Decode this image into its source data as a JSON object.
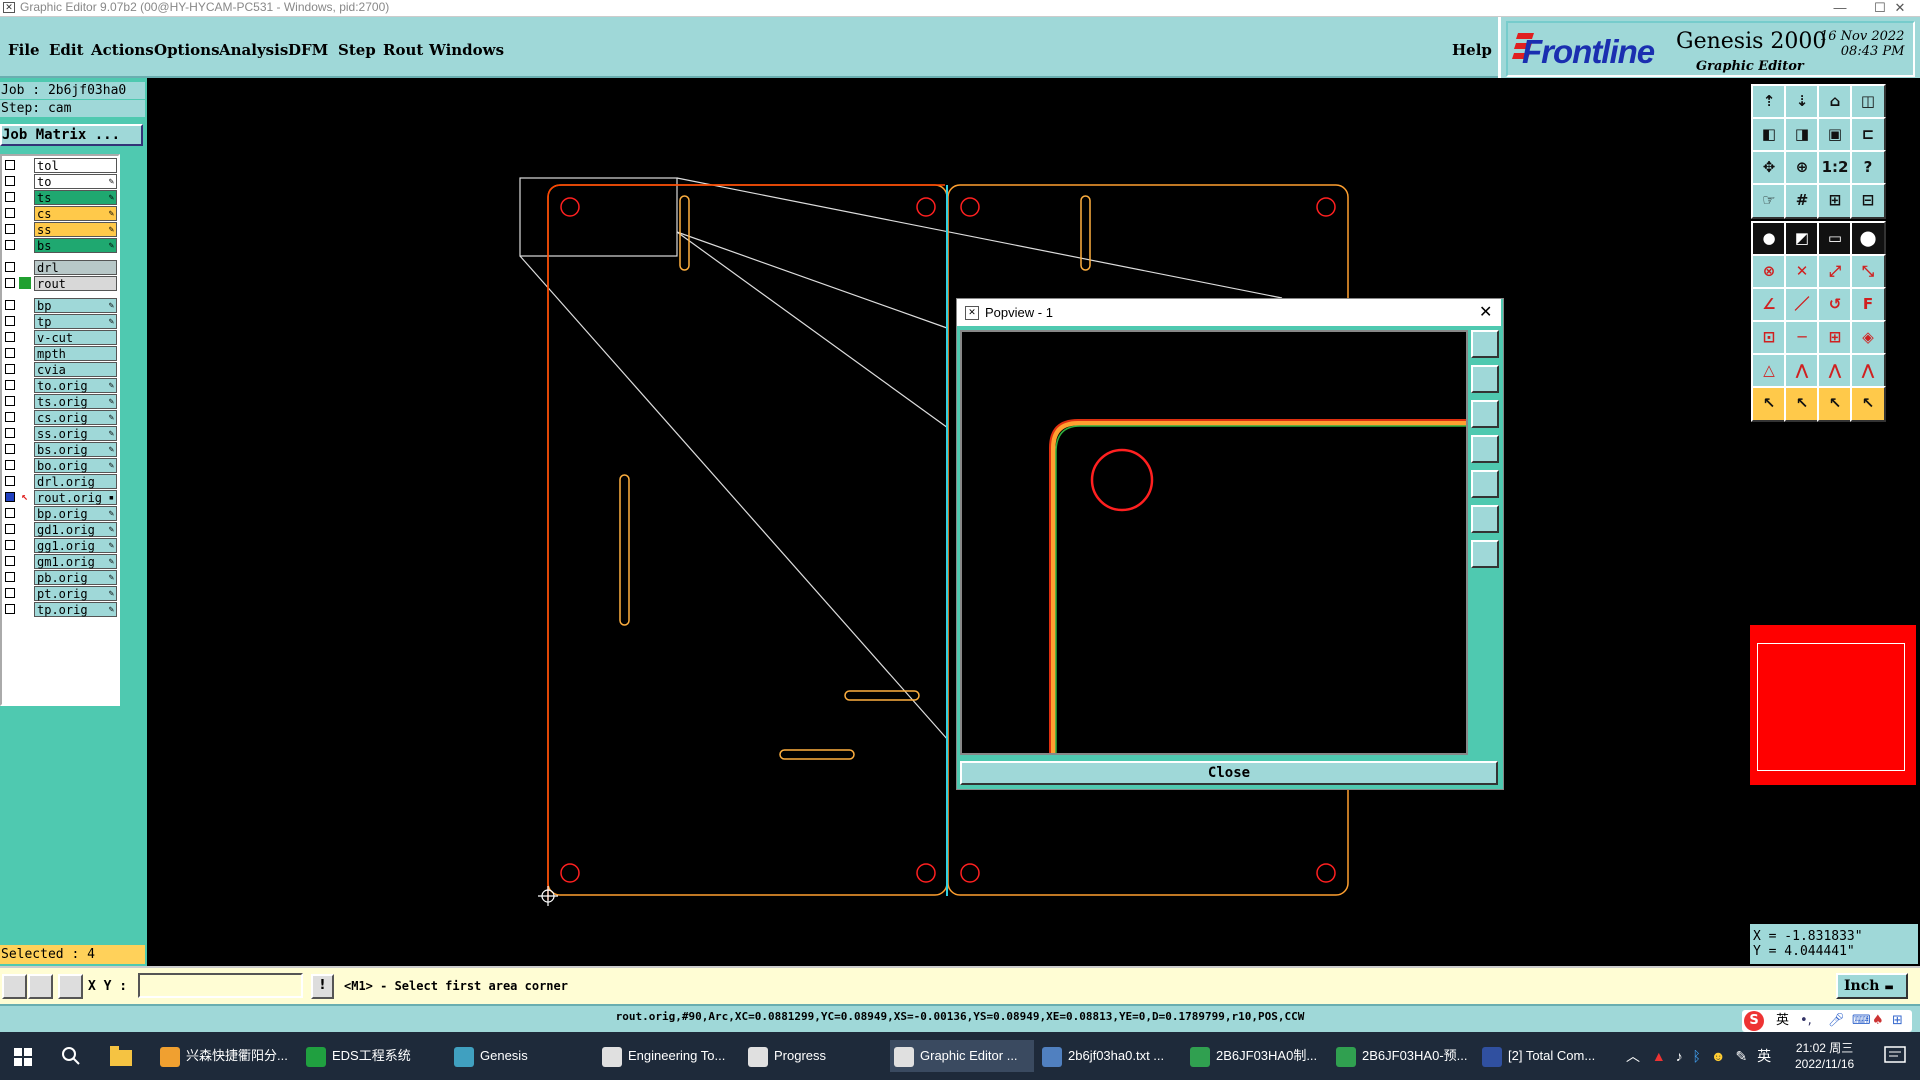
{
  "window": {
    "title": "Graphic Editor 9.07b2 (00@HY-HYCAM-PC531 - Windows, pid:2700)",
    "min": "—",
    "max": "☐",
    "close": "✕"
  },
  "menu": [
    "File",
    "Edit",
    "Actions",
    "Options",
    "Analysis",
    "DFM",
    "Step",
    "Rout",
    "Windows"
  ],
  "help": "Help",
  "logo": {
    "brand": "Frontline",
    "product": "Genesis 2000",
    "subtitle": "Graphic Editor",
    "date": "16 Nov 2022",
    "time": "08:43 PM"
  },
  "job": {
    "job_line": "Job : 2b6jf03ha0",
    "step_line": "Step: cam",
    "matrix_button": "Job Matrix ..."
  },
  "layers": [
    {
      "name": "tol",
      "color": "#ffffff",
      "edit": ""
    },
    {
      "name": "to",
      "color": "#ffffff",
      "edit": "✎"
    },
    {
      "name": "ts",
      "color": "#1fa870",
      "edit": "✎"
    },
    {
      "name": "cs",
      "color": "#ffc94a",
      "edit": "✎"
    },
    {
      "name": "ss",
      "color": "#ffc94a",
      "edit": "✎"
    },
    {
      "name": "bs",
      "color": "#1fa870",
      "edit": "✎"
    },
    {
      "name": "drl",
      "color": "#b8c8c8",
      "edit": ""
    },
    {
      "name": "rout",
      "color": "#d8d8d8",
      "edit": ""
    },
    {
      "name": "bp",
      "color": "#9fd8d8",
      "edit": "✎"
    },
    {
      "name": "tp",
      "color": "#9fd8d8",
      "edit": "✎"
    },
    {
      "name": "v-cut",
      "color": "#9fd8d8",
      "edit": ""
    },
    {
      "name": "mpth",
      "color": "#9fd8d8",
      "edit": ""
    },
    {
      "name": "cvia",
      "color": "#9fd8d8",
      "edit": ""
    },
    {
      "name": "to.orig",
      "color": "#9fd8d8",
      "edit": "✎"
    },
    {
      "name": "ts.orig",
      "color": "#9fd8d8",
      "edit": "✎"
    },
    {
      "name": "cs.orig",
      "color": "#9fd8d8",
      "edit": "✎"
    },
    {
      "name": "ss.orig",
      "color": "#9fd8d8",
      "edit": "✎"
    },
    {
      "name": "bs.orig",
      "color": "#9fd8d8",
      "edit": "✎"
    },
    {
      "name": "bo.orig",
      "color": "#9fd8d8",
      "edit": "✎"
    },
    {
      "name": "drl.orig",
      "color": "#9fd8d8",
      "edit": ""
    },
    {
      "name": "rout.orig",
      "color": "#9fd8d8",
      "edit": "▪"
    },
    {
      "name": "bp.orig",
      "color": "#9fd8d8",
      "edit": "✎"
    },
    {
      "name": "gd1.orig",
      "color": "#9fd8d8",
      "edit": "✎"
    },
    {
      "name": "gg1.orig",
      "color": "#9fd8d8",
      "edit": "✎"
    },
    {
      "name": "gm1.orig",
      "color": "#9fd8d8",
      "edit": "✎"
    },
    {
      "name": "pb.orig",
      "color": "#9fd8d8",
      "edit": "✎"
    },
    {
      "name": "pt.orig",
      "color": "#9fd8d8",
      "edit": "✎"
    },
    {
      "name": "tp.orig",
      "color": "#9fd8d8",
      "edit": "✎"
    }
  ],
  "selected": "Selected : 4",
  "popview": {
    "title": "Popview - 1",
    "close_label": "Close"
  },
  "coords": {
    "x": "X = -1.831833\"",
    "y": "Y = 4.044441\""
  },
  "cmd": {
    "xy_label": "X Y :",
    "xy_value": "",
    "bang": "!",
    "prompt": "<M1> - Select first area corner",
    "units": "Inch"
  },
  "status": "rout.orig,#90,Arc,XC=0.0881299,YC=0.08949,XS=-0.00136,YS=0.08949,XE=0.08813,YE=0,D=0.1789799,r10,POS,CCW",
  "taskbar": {
    "tasks": [
      {
        "label": "兴森快捷衢阳分...",
        "color": "#f0a030"
      },
      {
        "label": "EDS工程系统",
        "color": "#20a040"
      },
      {
        "label": "Genesis",
        "color": "#40a0c0"
      },
      {
        "label": "Engineering To...",
        "color": "#e0e0e0"
      },
      {
        "label": "Progress",
        "color": "#e0e0e0"
      },
      {
        "label": "Graphic Editor ...",
        "color": "#e0e0e0"
      },
      {
        "label": "2b6jf03ha0.txt ...",
        "color": "#5080c0"
      },
      {
        "label": "2B6JF03HA0制...",
        "color": "#30a050"
      },
      {
        "label": "2B6JF03HA0-预...",
        "color": "#30a050"
      },
      {
        "label": "[2] Total Com...",
        "color": "#3050a0"
      }
    ],
    "time": "21:02 周三",
    "date": "2022/11/16",
    "ime": "英",
    "lang": "英"
  },
  "colors": {
    "panel": "#4fc9b0",
    "menu": "#9fd8d8",
    "rout": "#ff5a00",
    "profile": "#ffb040",
    "drill": "#ff2020",
    "cyan_line": "#30d0e0"
  }
}
